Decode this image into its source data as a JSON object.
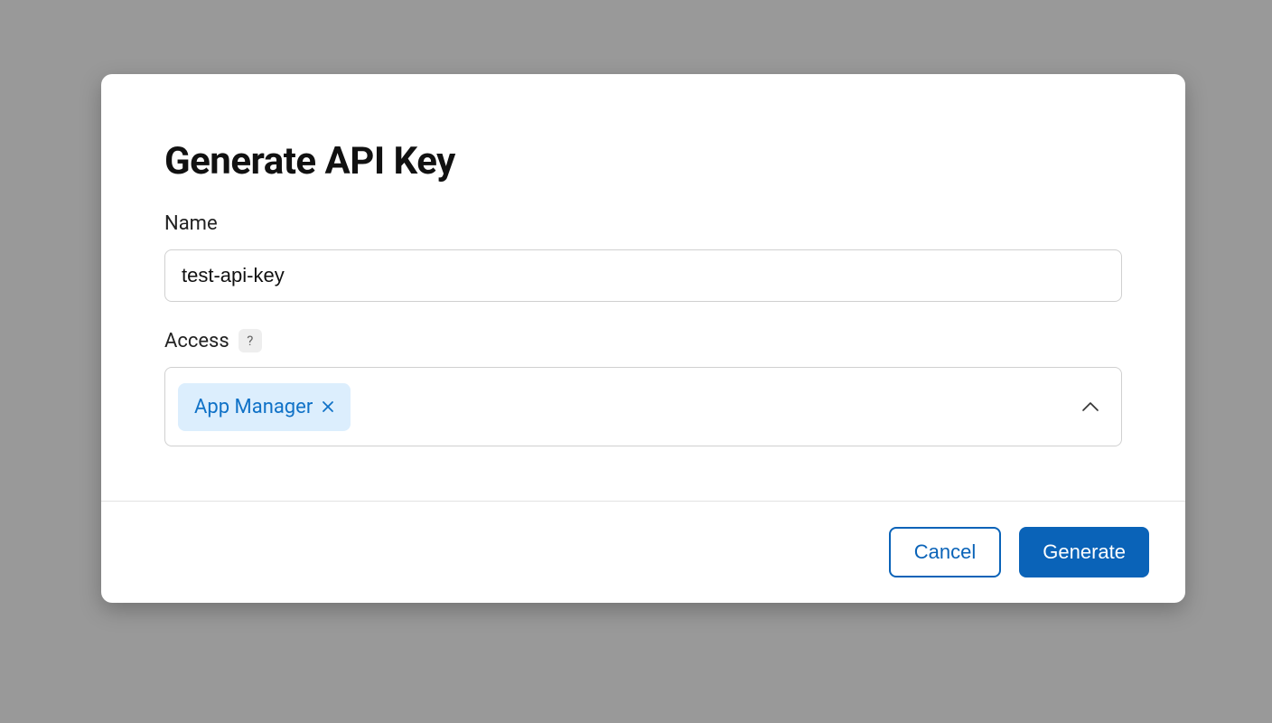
{
  "modal": {
    "title": "Generate API Key",
    "fields": {
      "name": {
        "label": "Name",
        "value": "test-api-key"
      },
      "access": {
        "label": "Access",
        "help": "?",
        "chips": [
          {
            "label": "App Manager"
          }
        ]
      }
    },
    "actions": {
      "cancel": "Cancel",
      "generate": "Generate"
    }
  }
}
